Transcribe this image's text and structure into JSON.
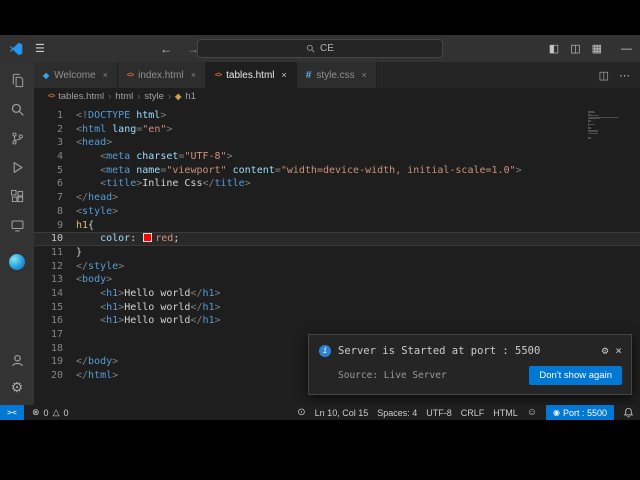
{
  "colors": {
    "accent": "#0078d4",
    "swatch": "#ff0000"
  },
  "icons": {
    "close": "×",
    "chevron": "›",
    "gear": "⚙",
    "smiley": "☺",
    "back": "←",
    "forward": "→",
    "hamburger": "☰",
    "error": "⊗",
    "warning": "△",
    "html": "<>",
    "css": "#",
    "vscode": "◆",
    "symbol": "◈",
    "broadcast": "◉",
    "zoom": "⊙",
    "split": "◫",
    "more": "⋯",
    "layout_sidebar": "◧",
    "layout_panel": "◫",
    "layout_grid": "▦",
    "minimize": "—",
    "info": "i"
  },
  "title_bar": {
    "search_text": "CE"
  },
  "tabs": [
    {
      "label": "Welcome",
      "icon": "vscode",
      "active": false
    },
    {
      "label": "index.html",
      "icon": "html",
      "active": false
    },
    {
      "label": "tables.html",
      "icon": "html",
      "active": true
    },
    {
      "label": "style.css",
      "icon": "css",
      "active": false
    }
  ],
  "breadcrumb": {
    "items": [
      {
        "label": "tables.html",
        "icon": "html"
      },
      {
        "label": "html"
      },
      {
        "label": "style"
      },
      {
        "label": "h1",
        "icon": "symbol"
      }
    ]
  },
  "editor": {
    "current_line": 10,
    "lines": [
      {
        "n": 1,
        "tokens": [
          [
            "<!",
            "punct"
          ],
          [
            "DOCTYPE",
            "tag"
          ],
          [
            " ",
            "plain"
          ],
          [
            "html",
            "attr"
          ],
          [
            ">",
            "punct"
          ]
        ]
      },
      {
        "n": 2,
        "tokens": [
          [
            "<",
            "punct"
          ],
          [
            "html",
            "tag"
          ],
          [
            " ",
            "plain"
          ],
          [
            "lang",
            "attr"
          ],
          [
            "=",
            "punct"
          ],
          [
            "\"en\"",
            "str"
          ],
          [
            ">",
            "punct"
          ]
        ]
      },
      {
        "n": 3,
        "tokens": [
          [
            "<",
            "punct"
          ],
          [
            "head",
            "tag"
          ],
          [
            ">",
            "punct"
          ]
        ]
      },
      {
        "n": 4,
        "tokens": [
          [
            "    ",
            "plain"
          ],
          [
            "<",
            "punct"
          ],
          [
            "meta",
            "tag"
          ],
          [
            " ",
            "plain"
          ],
          [
            "charset",
            "attr"
          ],
          [
            "=",
            "punct"
          ],
          [
            "\"UTF-8\"",
            "str"
          ],
          [
            ">",
            "punct"
          ]
        ]
      },
      {
        "n": 5,
        "tokens": [
          [
            "    ",
            "plain"
          ],
          [
            "<",
            "punct"
          ],
          [
            "meta",
            "tag"
          ],
          [
            " ",
            "plain"
          ],
          [
            "name",
            "attr"
          ],
          [
            "=",
            "punct"
          ],
          [
            "\"viewport\"",
            "str"
          ],
          [
            " ",
            "plain"
          ],
          [
            "content",
            "attr"
          ],
          [
            "=",
            "punct"
          ],
          [
            "\"width=device-width, initial-scale=1.0\"",
            "str"
          ],
          [
            ">",
            "punct"
          ]
        ]
      },
      {
        "n": 6,
        "tokens": [
          [
            "    ",
            "plain"
          ],
          [
            "<",
            "punct"
          ],
          [
            "title",
            "tag"
          ],
          [
            ">",
            "punct"
          ],
          [
            "Inline Css",
            "text"
          ],
          [
            "</",
            "punct"
          ],
          [
            "title",
            "tag"
          ],
          [
            ">",
            "punct"
          ]
        ]
      },
      {
        "n": 7,
        "tokens": [
          [
            "</",
            "punct"
          ],
          [
            "head",
            "tag"
          ],
          [
            ">",
            "punct"
          ]
        ]
      },
      {
        "n": 8,
        "tokens": [
          [
            "<",
            "punct"
          ],
          [
            "style",
            "tag"
          ],
          [
            ">",
            "punct"
          ]
        ]
      },
      {
        "n": 9,
        "tokens": [
          [
            "h1",
            "sel"
          ],
          [
            "{",
            "plain"
          ]
        ]
      },
      {
        "n": 10,
        "tokens": [
          [
            "    ",
            "plain"
          ],
          [
            "color",
            "prop"
          ],
          [
            ": ",
            "plain"
          ],
          [
            "",
            "swatch"
          ],
          [
            "red",
            "val"
          ],
          [
            ";",
            "plain"
          ]
        ]
      },
      {
        "n": 11,
        "tokens": [
          [
            "}",
            "plain"
          ]
        ]
      },
      {
        "n": 12,
        "tokens": [
          [
            "</",
            "punct"
          ],
          [
            "style",
            "tag"
          ],
          [
            ">",
            "punct"
          ]
        ]
      },
      {
        "n": 13,
        "tokens": [
          [
            "<",
            "punct"
          ],
          [
            "body",
            "tag"
          ],
          [
            ">",
            "punct"
          ]
        ]
      },
      {
        "n": 14,
        "tokens": [
          [
            "    ",
            "plain"
          ],
          [
            "<",
            "punct"
          ],
          [
            "h1",
            "tag"
          ],
          [
            ">",
            "punct"
          ],
          [
            "Hello world",
            "text"
          ],
          [
            "</",
            "punct"
          ],
          [
            "h1",
            "tag"
          ],
          [
            ">",
            "punct"
          ]
        ]
      },
      {
        "n": 15,
        "tokens": [
          [
            "    ",
            "plain"
          ],
          [
            "<",
            "punct"
          ],
          [
            "h1",
            "tag"
          ],
          [
            ">",
            "punct"
          ],
          [
            "Hello world",
            "text"
          ],
          [
            "</",
            "punct"
          ],
          [
            "h1",
            "tag"
          ],
          [
            ">",
            "punct"
          ]
        ]
      },
      {
        "n": 16,
        "tokens": [
          [
            "    ",
            "plain"
          ],
          [
            "<",
            "punct"
          ],
          [
            "h1",
            "tag"
          ],
          [
            ">",
            "punct"
          ],
          [
            "Hello world",
            "text"
          ],
          [
            "</",
            "punct"
          ],
          [
            "h1",
            "tag"
          ],
          [
            ">",
            "punct"
          ]
        ]
      },
      {
        "n": 17,
        "tokens": []
      },
      {
        "n": 18,
        "tokens": []
      },
      {
        "n": 19,
        "tokens": [
          [
            "</",
            "punct"
          ],
          [
            "body",
            "tag"
          ],
          [
            ">",
            "punct"
          ]
        ]
      },
      {
        "n": 20,
        "tokens": [
          [
            "</",
            "punct"
          ],
          [
            "html",
            "tag"
          ],
          [
            ">",
            "punct"
          ]
        ]
      }
    ]
  },
  "notification": {
    "message": "Server is Started at port : 5500",
    "source": "Source: Live Server",
    "button_label": "Don't show again"
  },
  "status_bar": {
    "remote_glyph": "><",
    "errors": "0",
    "warnings": "0",
    "items": [
      {
        "name": "cursor-position",
        "label": "Ln 10, Col 15"
      },
      {
        "name": "indentation",
        "label": "Spaces: 4"
      },
      {
        "name": "encoding",
        "label": "UTF-8"
      },
      {
        "name": "eol-sequence",
        "label": "CRLF"
      },
      {
        "name": "language-mode",
        "label": "HTML"
      }
    ],
    "port": "Port : 5500"
  }
}
